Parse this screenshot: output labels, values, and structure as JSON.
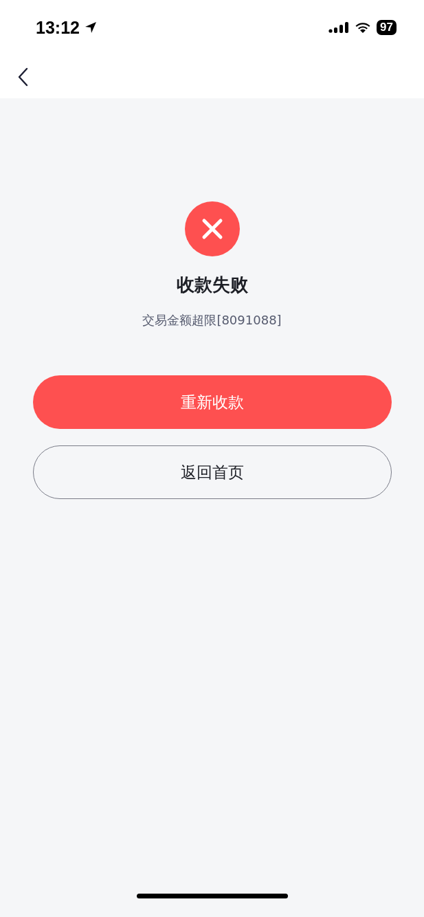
{
  "status_bar": {
    "time": "13:12",
    "battery": "97"
  },
  "result": {
    "kind": "failure",
    "title": "收款失败",
    "message": "交易金额超限[8091088]"
  },
  "buttons": [
    {
      "label": "重新收款",
      "kind": "primary"
    },
    {
      "label": "返回首页",
      "kind": "secondary"
    }
  ]
}
